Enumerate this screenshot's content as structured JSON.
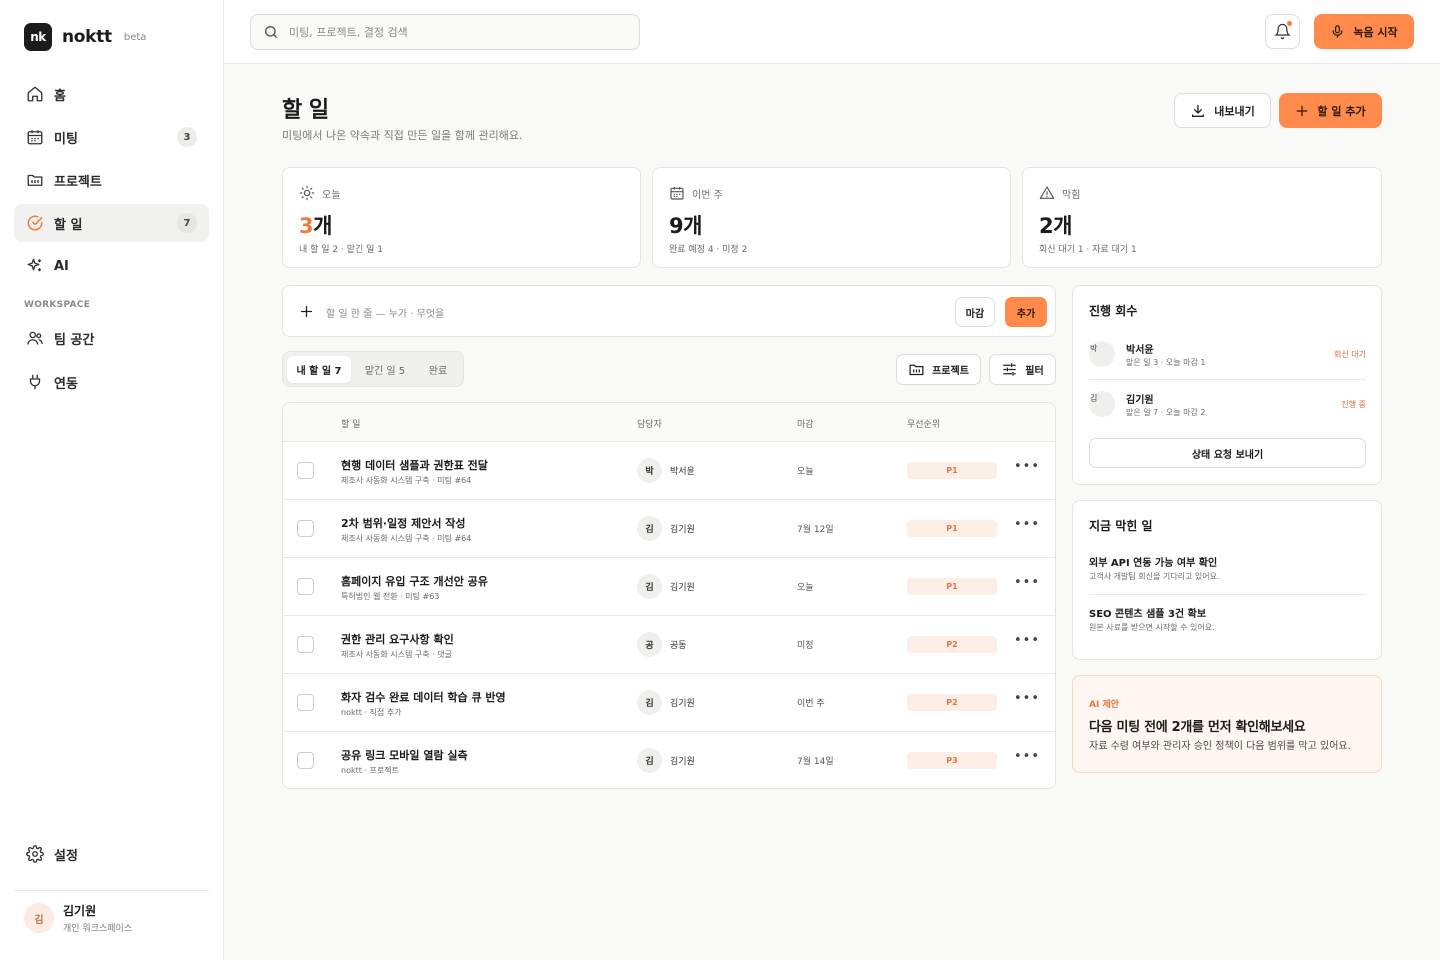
{
  "brand": {
    "logo": "nk",
    "name": "noktt",
    "tag": "beta"
  },
  "sidebar": {
    "items": [
      {
        "label": "홈",
        "icon": "home-icon"
      },
      {
        "label": "미팅",
        "icon": "calendar-icon",
        "badge": "3"
      },
      {
        "label": "프로젝트",
        "icon": "folder-icon"
      },
      {
        "label": "할 일",
        "icon": "check-circle-icon",
        "badge": "7",
        "active": true
      },
      {
        "label": "AI",
        "icon": "sparkle-icon"
      }
    ],
    "section_label": "WORKSPACE",
    "workspace_items": [
      {
        "label": "팀 공간",
        "icon": "team-icon"
      },
      {
        "label": "연동",
        "icon": "plug-icon"
      }
    ],
    "settings": {
      "label": "설정",
      "icon": "gear-icon"
    },
    "user": {
      "avatar": "김",
      "name": "김기원",
      "workspace": "개인 워크스페이스"
    }
  },
  "topbar": {
    "search_placeholder": "미팅, 프로젝트, 결정 검색",
    "record_label": "녹음 시작"
  },
  "page": {
    "title": "할 일",
    "subtitle": "미팅에서 나온 약속과 직접 만든 일을 함께 관리해요.",
    "export_label": "내보내기",
    "add_label": "할 일 추가"
  },
  "stats": [
    {
      "label": "오늘",
      "value_num": "3",
      "value_unit": "개",
      "sub": "내 할 일 2 · 맡긴 일 1",
      "accent": "#ef7a3d",
      "icon": "sun-icon"
    },
    {
      "label": "이번 주",
      "value_num": "9",
      "value_unit": "개",
      "sub": "완료 예정 4 · 미정 2",
      "icon": "calendar-icon"
    },
    {
      "label": "막힘",
      "value_num": "2",
      "value_unit": "개",
      "sub": "회신 대기 1 · 자료 대기 1",
      "icon": "warning-icon"
    }
  ],
  "quick_add": {
    "placeholder": "할 일 한 줄 — 누가 · 무엇을",
    "deadline_label": "마감",
    "add_label": "추가"
  },
  "tabs": [
    {
      "label": "내 할 일 7",
      "active": true
    },
    {
      "label": "맡긴 일 5"
    },
    {
      "label": "완료"
    }
  ],
  "tools": {
    "project_label": "프로젝트",
    "filter_label": "필터"
  },
  "table": {
    "headers": [
      "할 일",
      "담당자",
      "마감",
      "우선순위"
    ],
    "rows": [
      {
        "title": "현행 데이터 샘플과 권한표 전달",
        "meta": "제조사 사동화 시스템 구축 · 미팅 #64",
        "avatar": "박",
        "owner": "박서윤",
        "due": "오늘",
        "priority": "P1"
      },
      {
        "title": "2차 범위·일정 제안서 작성",
        "meta": "제조사 사동화 시스템 구축 · 미팅 #64",
        "avatar": "김",
        "owner": "김기원",
        "due": "7월 12일",
        "priority": "P1"
      },
      {
        "title": "홈페이지 유입 구조 개선안 공유",
        "meta": "특허법인 웹 전환 · 미팅 #63",
        "avatar": "김",
        "owner": "김기원",
        "due": "오늘",
        "priority": "P1"
      },
      {
        "title": "권한 관리 요구사항 확인",
        "meta": "제조사 사동화 시스템 구축 · 댓글",
        "avatar": "공",
        "owner": "공동",
        "due": "미정",
        "priority": "P2"
      },
      {
        "title": "화자 검수 완료 데이터 학습 큐 반영",
        "meta": "noktt · 직접 추가",
        "avatar": "김",
        "owner": "김기원",
        "due": "이번 주",
        "priority": "P2"
      },
      {
        "title": "공유 링크 모바일 열람 실측",
        "meta": "noktt · 프로젝트",
        "avatar": "김",
        "owner": "김기원",
        "due": "7월 14일",
        "priority": "P3"
      }
    ],
    "more_label": "•••"
  },
  "progress_panel": {
    "title": "진행 회수",
    "people": [
      {
        "avatar": "박",
        "name": "박서윤",
        "sub": "맡은 일 3 · 오늘 마감 1",
        "status": "회신 대기"
      },
      {
        "avatar": "김",
        "name": "김기원",
        "sub": "맡은 일 7 · 오늘 마감 2",
        "status": "진행 중"
      }
    ],
    "button": "상태 요청 보내기"
  },
  "blocked_panel": {
    "title": "지금 막힌 일",
    "items": [
      {
        "title": "외부 API 연동 가능 여부 확인",
        "sub": "고객사 개발팀 회신을 기다리고 있어요."
      },
      {
        "title": "SEO 콘텐츠 샘플 3건 확보",
        "sub": "원본 사료를 받으면 시작할 수 있어요."
      }
    ]
  },
  "ai_panel": {
    "tag": "AI 제안",
    "title": "다음 미팅 전에 2개를 먼저 확인해보세요",
    "body": "자료 수령 여부와 관리자 승인 정책이 다음 범위를 막고 있어요."
  },
  "colors": {
    "accent": "#ff8a4c",
    "accent_text": "#e8763c",
    "priority_bg": "#fdeee6"
  }
}
